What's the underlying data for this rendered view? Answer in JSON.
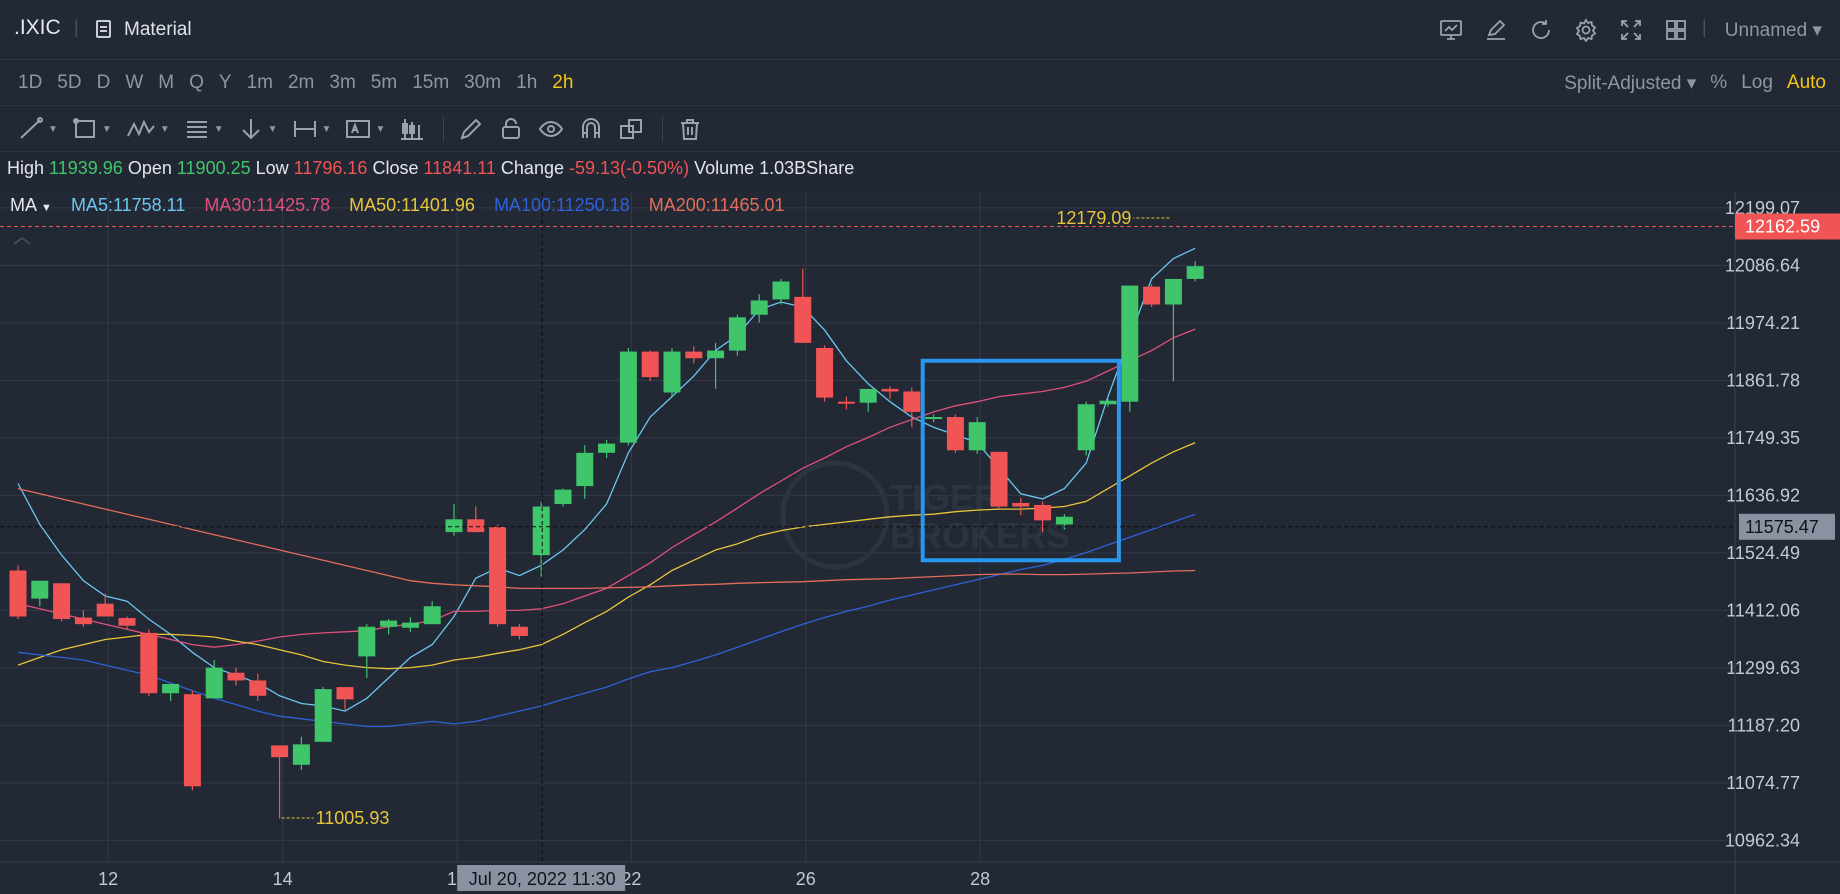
{
  "header": {
    "symbol": ".IXIC",
    "theme_label": "Material",
    "layout_name": "Unnamed ▾",
    "icons": [
      "chart-icon",
      "draw-icon",
      "refresh-icon",
      "settings-icon",
      "fullscreen-icon",
      "grid-layout-icon"
    ]
  },
  "periods": {
    "items": [
      "1D",
      "5D",
      "D",
      "W",
      "M",
      "Q",
      "Y",
      "1m",
      "2m",
      "3m",
      "5m",
      "15m",
      "30m",
      "1h",
      "2h"
    ],
    "active": "2h",
    "adjust_label": "Split-Adjusted ▾",
    "percent_label": "%",
    "log_label": "Log",
    "auto_label": "Auto"
  },
  "toolbar": {
    "tools": [
      "line-tool-icon",
      "rectangle-tool-icon",
      "pattern-tool-icon",
      "fib-tool-icon",
      "arrow-tool-icon",
      "measure-tool-icon",
      "text-tool-icon",
      "candle-tool-icon",
      "pencil-icon",
      "lock-icon",
      "eye-icon",
      "magnet-icon",
      "clone-icon",
      "trash-icon"
    ]
  },
  "info": {
    "high_label": "High",
    "high": "11939.96",
    "open_label": "Open",
    "open": "11900.25",
    "low_label": "Low",
    "low": "11796.16",
    "close_label": "Close",
    "close": "11841.11",
    "change_label": "Change",
    "change": "-59.13(-0.50%)",
    "volume_label": "Volume",
    "volume": "1.03BShare"
  },
  "indicators": {
    "ma_label": "MA",
    "ma5": "MA5:11758.11",
    "ma30": "MA30:11425.78",
    "ma50": "MA50:11401.96",
    "ma100": "MA100:11250.18",
    "ma200": "MA200:11465.01",
    "colors": {
      "ma5": "#6cc6f0",
      "ma30": "#e0507a",
      "ma50": "#e8c53a",
      "ma100": "#2f62d8",
      "ma200": "#e26d5a"
    }
  },
  "chart_data": {
    "type": "candlestick",
    "ylim": [
      10920,
      12230
    ],
    "y_ticks": [
      12199.07,
      12086.64,
      11974.21,
      11861.78,
      11749.35,
      11636.92,
      11524.49,
      11412.06,
      11299.63,
      11187.2,
      11074.77,
      10962.34
    ],
    "y_tick_labels": [
      "12199.07",
      "12086.64",
      "11974.21",
      "11861.78",
      "11749.35",
      "11636.92",
      "11524.49",
      "11412.06",
      "11299.63",
      "11187.20",
      "11074.77",
      "10962.34"
    ],
    "x_tick_labels": [
      "12",
      "14",
      "18",
      "22",
      "26",
      "28"
    ],
    "x_tick_bars": [
      4,
      12,
      20,
      28,
      36,
      44
    ],
    "crosshair_label": "Jul 20, 2022 11:30",
    "crosshair_bar": 24,
    "crosshair_price": 11575.47,
    "crosshair_price_label": "11575.47",
    "last_price": 12162.59,
    "last_price_label": "12162.59",
    "high_marker": {
      "bar": 53,
      "value": 12179.09,
      "label": "12179.09"
    },
    "low_marker": {
      "bar": 12,
      "value": 11005.93,
      "label": "11005.93"
    },
    "colors": {
      "up": "#3fc66b",
      "down": "#f05454",
      "highlight_box": "#2997ee"
    },
    "highlight_box": {
      "from_bar": 41.5,
      "to_bar": 50.5,
      "top": 11900,
      "bottom": 11510
    },
    "candles": [
      {
        "o": 11490,
        "h": 11500,
        "l": 11395,
        "c": 11400
      },
      {
        "o": 11435,
        "h": 11470,
        "l": 11420,
        "c": 11470
      },
      {
        "o": 11465,
        "h": 11465,
        "l": 11390,
        "c": 11395
      },
      {
        "o": 11398,
        "h": 11412,
        "l": 11380,
        "c": 11385
      },
      {
        "o": 11425,
        "h": 11445,
        "l": 11400,
        "c": 11400
      },
      {
        "o": 11397,
        "h": 11400,
        "l": 11375,
        "c": 11382
      },
      {
        "o": 11368,
        "h": 11375,
        "l": 11245,
        "c": 11250
      },
      {
        "o": 11250,
        "h": 11268,
        "l": 11235,
        "c": 11268
      },
      {
        "o": 11248,
        "h": 11255,
        "l": 11060,
        "c": 11068
      },
      {
        "o": 11240,
        "h": 11315,
        "l": 11240,
        "c": 11300
      },
      {
        "o": 11290,
        "h": 11300,
        "l": 11265,
        "c": 11275
      },
      {
        "o": 11275,
        "h": 11288,
        "l": 11235,
        "c": 11245
      },
      {
        "o": 11148,
        "h": 11148,
        "l": 11005,
        "c": 11125
      },
      {
        "o": 11110,
        "h": 11165,
        "l": 11100,
        "c": 11150
      },
      {
        "o": 11155,
        "h": 11262,
        "l": 11155,
        "c": 11258
      },
      {
        "o": 11262,
        "h": 11262,
        "l": 11218,
        "c": 11238
      },
      {
        "o": 11322,
        "h": 11385,
        "l": 11280,
        "c": 11380
      },
      {
        "o": 11380,
        "h": 11395,
        "l": 11365,
        "c": 11392
      },
      {
        "o": 11378,
        "h": 11398,
        "l": 11370,
        "c": 11388
      },
      {
        "o": 11385,
        "h": 11430,
        "l": 11385,
        "c": 11420
      },
      {
        "o": 11565,
        "h": 11620,
        "l": 11558,
        "c": 11590
      },
      {
        "o": 11590,
        "h": 11615,
        "l": 11565,
        "c": 11565
      },
      {
        "o": 11575,
        "h": 11580,
        "l": 11380,
        "c": 11385
      },
      {
        "o": 11380,
        "h": 11385,
        "l": 11355,
        "c": 11362
      },
      {
        "o": 11520,
        "h": 11625,
        "l": 11478,
        "c": 11615
      },
      {
        "o": 11620,
        "h": 11650,
        "l": 11615,
        "c": 11648
      },
      {
        "o": 11655,
        "h": 11735,
        "l": 11630,
        "c": 11720
      },
      {
        "o": 11720,
        "h": 11745,
        "l": 11710,
        "c": 11738
      },
      {
        "o": 11740,
        "h": 11925,
        "l": 11735,
        "c": 11918
      },
      {
        "o": 11918,
        "h": 11920,
        "l": 11860,
        "c": 11868
      },
      {
        "o": 11838,
        "h": 11925,
        "l": 11830,
        "c": 11918
      },
      {
        "o": 11918,
        "h": 11928,
        "l": 11895,
        "c": 11905
      },
      {
        "o": 11905,
        "h": 11935,
        "l": 11845,
        "c": 11920
      },
      {
        "o": 11920,
        "h": 11990,
        "l": 11910,
        "c": 11985
      },
      {
        "o": 11990,
        "h": 12030,
        "l": 11975,
        "c": 12018
      },
      {
        "o": 12020,
        "h": 12060,
        "l": 12010,
        "c": 12055
      },
      {
        "o": 12025,
        "h": 12080,
        "l": 11935,
        "c": 11935
      },
      {
        "o": 11925,
        "h": 11930,
        "l": 11820,
        "c": 11828
      },
      {
        "o": 11820,
        "h": 11830,
        "l": 11805,
        "c": 11818
      },
      {
        "o": 11818,
        "h": 11845,
        "l": 11800,
        "c": 11845
      },
      {
        "o": 11845,
        "h": 11850,
        "l": 11825,
        "c": 11840
      },
      {
        "o": 11840,
        "h": 11848,
        "l": 11770,
        "c": 11800
      },
      {
        "o": 11788,
        "h": 11795,
        "l": 11780,
        "c": 11790
      },
      {
        "o": 11790,
        "h": 11795,
        "l": 11720,
        "c": 11725
      },
      {
        "o": 11725,
        "h": 11790,
        "l": 11718,
        "c": 11780
      },
      {
        "o": 11722,
        "h": 11722,
        "l": 11610,
        "c": 11615
      },
      {
        "o": 11622,
        "h": 11632,
        "l": 11598,
        "c": 11615
      },
      {
        "o": 11618,
        "h": 11625,
        "l": 11565,
        "c": 11588
      },
      {
        "o": 11580,
        "h": 11600,
        "l": 11570,
        "c": 11595
      },
      {
        "o": 11725,
        "h": 11820,
        "l": 11715,
        "c": 11815
      },
      {
        "o": 11815,
        "h": 11825,
        "l": 11810,
        "c": 11822
      },
      {
        "o": 11820,
        "h": 11905,
        "l": 11800,
        "c": 12047
      },
      {
        "o": 12045,
        "h": 12050,
        "l": 12005,
        "c": 12010
      },
      {
        "o": 12010,
        "h": 12060,
        "l": 11860,
        "c": 12060
      },
      {
        "o": 12060,
        "h": 12095,
        "l": 12055,
        "c": 12085
      }
    ],
    "series": [
      {
        "name": "MA5",
        "color": "#6cc6f0",
        "values": [
          11660,
          11580,
          11520,
          11470,
          11440,
          11430,
          11395,
          11365,
          11330,
          11300,
          11285,
          11270,
          11245,
          11230,
          11225,
          11215,
          11240,
          11280,
          11320,
          11345,
          11400,
          11475,
          11495,
          11480,
          11500,
          11530,
          11570,
          11620,
          11720,
          11790,
          11830,
          11870,
          11920,
          11950,
          12000,
          12015,
          12005,
          11960,
          11900,
          11855,
          11820,
          11790,
          11770,
          11755,
          11740,
          11690,
          11640,
          11630,
          11650,
          11700,
          11830,
          11945,
          12060,
          12100,
          12120
        ]
      },
      {
        "name": "MA30",
        "color": "#e0507a",
        "values": [
          11425,
          11415,
          11405,
          11395,
          11385,
          11375,
          11365,
          11355,
          11345,
          11340,
          11345,
          11352,
          11360,
          11365,
          11368,
          11370,
          11372,
          11380,
          11385,
          11392,
          11410,
          11410,
          11412,
          11412,
          11415,
          11425,
          11440,
          11455,
          11480,
          11505,
          11535,
          11560,
          11585,
          11612,
          11640,
          11665,
          11690,
          11710,
          11732,
          11750,
          11770,
          11785,
          11800,
          11812,
          11820,
          11830,
          11835,
          11840,
          11848,
          11860,
          11880,
          11900,
          11920,
          11945,
          11962
        ]
      },
      {
        "name": "MA50",
        "color": "#e8c53a",
        "values": [
          11305,
          11320,
          11335,
          11345,
          11355,
          11360,
          11365,
          11365,
          11363,
          11360,
          11352,
          11345,
          11335,
          11325,
          11312,
          11305,
          11300,
          11298,
          11300,
          11305,
          11315,
          11320,
          11328,
          11335,
          11345,
          11365,
          11388,
          11410,
          11438,
          11462,
          11490,
          11510,
          11530,
          11542,
          11558,
          11568,
          11575,
          11580,
          11585,
          11590,
          11595,
          11598,
          11600,
          11605,
          11608,
          11610,
          11610,
          11612,
          11615,
          11625,
          11650,
          11675,
          11700,
          11722,
          11740
        ]
      },
      {
        "name": "MA100",
        "color": "#2f62d8",
        "values": [
          11330,
          11325,
          11320,
          11315,
          11305,
          11295,
          11285,
          11270,
          11255,
          11240,
          11228,
          11215,
          11205,
          11200,
          11195,
          11190,
          11185,
          11185,
          11190,
          11195,
          11190,
          11195,
          11205,
          11215,
          11225,
          11238,
          11250,
          11262,
          11278,
          11292,
          11300,
          11312,
          11325,
          11340,
          11355,
          11370,
          11385,
          11398,
          11410,
          11420,
          11432,
          11442,
          11452,
          11462,
          11472,
          11482,
          11492,
          11500,
          11512,
          11525,
          11540,
          11555,
          11570,
          11585,
          11600
        ]
      },
      {
        "name": "MA200",
        "color": "#e26d5a",
        "values": [
          11650,
          11640,
          11630,
          11620,
          11610,
          11600,
          11590,
          11580,
          11570,
          11560,
          11550,
          11540,
          11530,
          11520,
          11510,
          11500,
          11490,
          11480,
          11470,
          11465,
          11462,
          11460,
          11458,
          11455,
          11455,
          11455,
          11455,
          11456,
          11457,
          11458,
          11460,
          11462,
          11463,
          11465,
          11466,
          11467,
          11468,
          11470,
          11472,
          11473,
          11474,
          11476,
          11478,
          11480,
          11482,
          11483,
          11483,
          11482,
          11482,
          11483,
          11484,
          11485,
          11487,
          11489,
          11490
        ]
      }
    ]
  }
}
